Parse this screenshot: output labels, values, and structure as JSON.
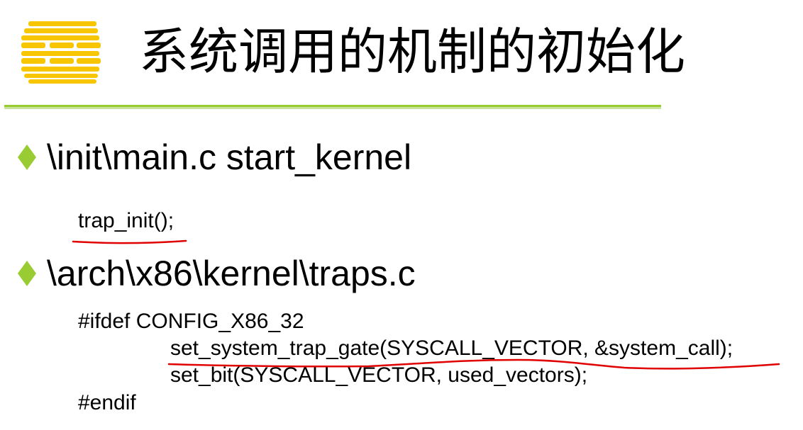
{
  "slide": {
    "title": "系统调用的机制的初始化",
    "bullets": [
      {
        "label": "\\init\\main.c start_kernel",
        "code_lines": [
          "trap_init();"
        ]
      },
      {
        "label": "\\arch\\x86\\kernel\\traps.c",
        "code_lines": [
          "#ifdef CONFIG_X86_32",
          "set_system_trap_gate(SYSCALL_VECTOR, &system_call);",
          "set_bit(SYSCALL_VECTOR, used_vectors);",
          "#endif"
        ]
      }
    ]
  },
  "colors": {
    "logo": "#f7c600",
    "accent": "#99cc33",
    "bullet": "#99cc33",
    "annotation": "#e00000"
  },
  "icons": {
    "logo": "striped-logo-icon",
    "bullet": "diamond-bullet-icon"
  }
}
